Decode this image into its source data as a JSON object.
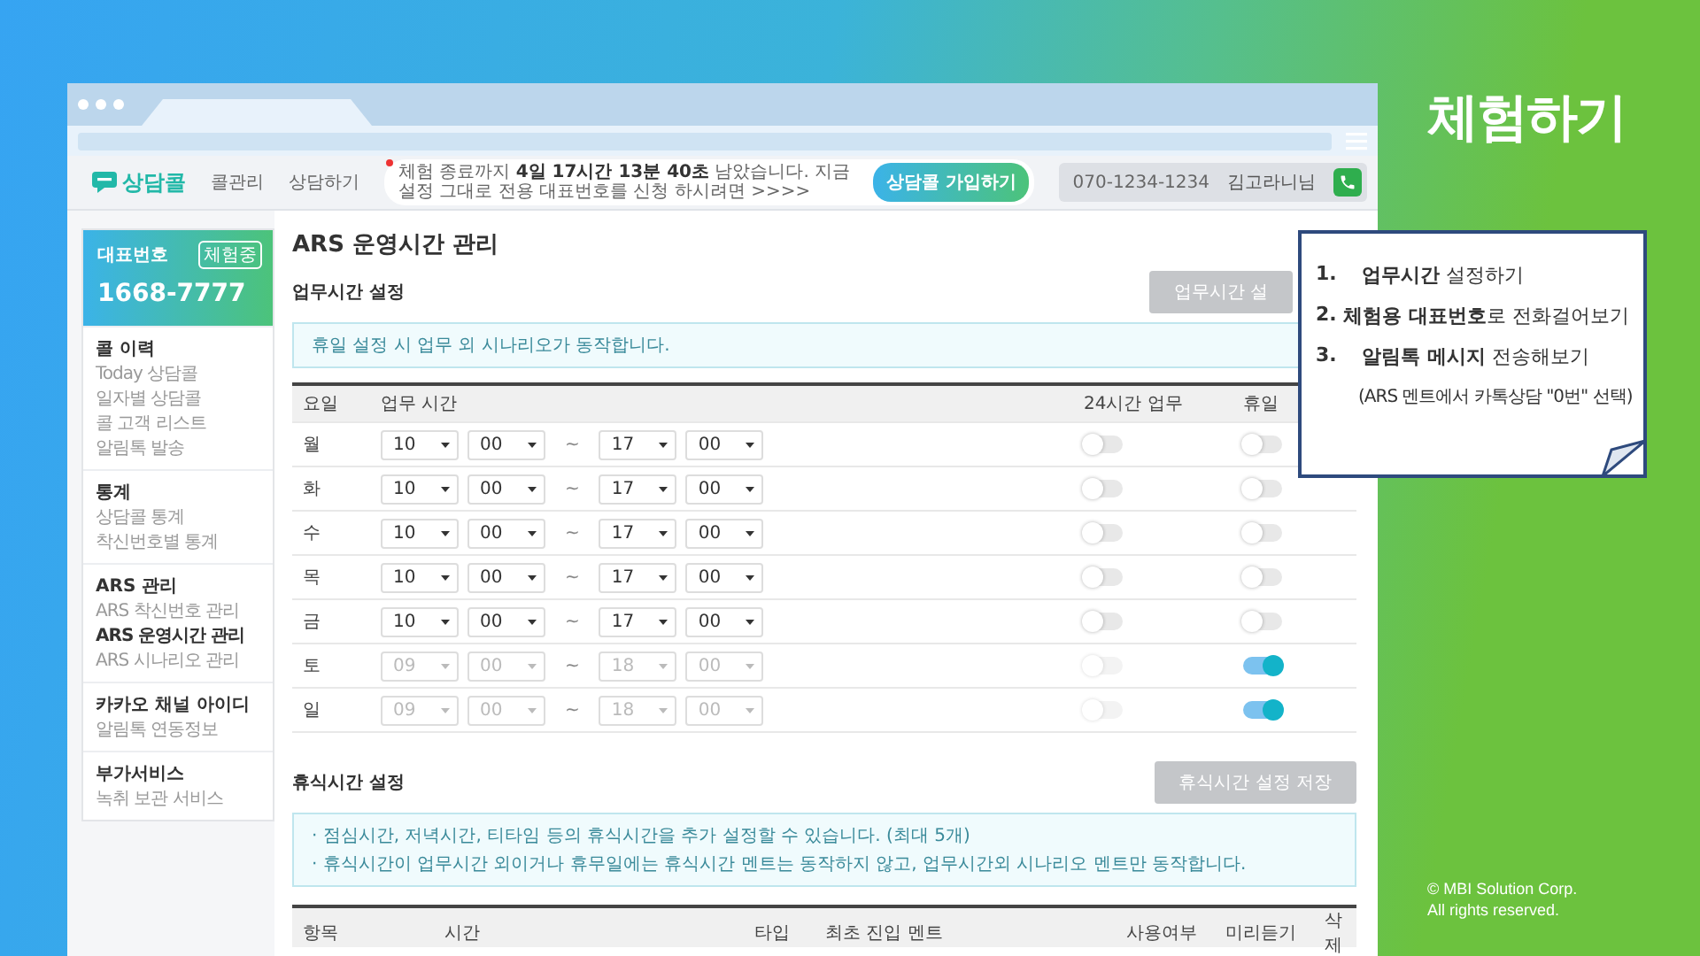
{
  "slide_title": "체험하기",
  "copyright": [
    "© MBI Solution Corp.",
    "All rights reserved."
  ],
  "callout": {
    "steps": [
      {
        "number": "1.",
        "text": "**업무시간** 설정하기"
      },
      {
        "number": "2.",
        "text": "**체험용 대표번호**로 전화걸어보기"
      },
      {
        "number": "3.",
        "text": "**알림톡 메시지** 전송해보기"
      }
    ],
    "note": "(ARS 멘트에서 카톡상담 \"0번\" 선택)"
  },
  "header": {
    "logo": "상담콜",
    "nav": [
      {
        "label": "콜관리",
        "selected": false
      },
      {
        "label": "상담하기",
        "selected": false
      }
    ],
    "notice": "체험 종료까지 **4일 17시간 13분 40초** 남았습니다. 지금 설정 그대로 전용 대표번호를 신청 하시려면 >>>>",
    "cta": "상담콜 가입하기",
    "phone": "070-1234-1234",
    "user": "김고라니님"
  },
  "sidebar": {
    "rep_label": "대표번호",
    "badge": "체험중",
    "rep_number": "1668-7777",
    "sections": [
      {
        "title": "콜 이력",
        "items": [
          {
            "label": "Today 상담콜",
            "selected": false
          },
          {
            "label": "일자별 상담콜",
            "selected": false
          },
          {
            "label": "콜 고객 리스트",
            "selected": false
          },
          {
            "label": "알림톡 발송",
            "selected": false
          }
        ]
      },
      {
        "title": "통계",
        "items": [
          {
            "label": "상담콜 통계",
            "selected": false
          },
          {
            "label": "착신번호별 통계",
            "selected": false
          }
        ]
      },
      {
        "title": "ARS 관리",
        "items": [
          {
            "label": "ARS 착신번호 관리",
            "selected": false
          },
          {
            "label": "ARS 운영시간 관리",
            "selected": true
          },
          {
            "label": "ARS 시나리오 관리",
            "selected": false
          }
        ]
      },
      {
        "title": "카카오 채널 아이디",
        "items": [
          {
            "label": "알림톡 연동정보",
            "selected": false
          }
        ]
      },
      {
        "title": "부가서비스",
        "items": [
          {
            "label": "녹취 보관 서비스",
            "selected": false
          }
        ]
      }
    ]
  },
  "page_title": "ARS 운영시간 관리",
  "business_hours": {
    "heading": "업무시간 설정",
    "save_button": "업무시간 설",
    "info": "휴일 설정 시 업무 외 시나리오가 동작합니다.",
    "columns": [
      "요일",
      "업무 시간",
      "24시간 업무",
      "휴일"
    ],
    "rows": [
      {
        "day": "월",
        "start_hour": "10",
        "start_min": "00",
        "end_hour": "17",
        "end_min": "00",
        "all_day": false,
        "holiday": false
      },
      {
        "day": "화",
        "start_hour": "10",
        "start_min": "00",
        "end_hour": "17",
        "end_min": "00",
        "all_day": false,
        "holiday": false
      },
      {
        "day": "수",
        "start_hour": "10",
        "start_min": "00",
        "end_hour": "17",
        "end_min": "00",
        "all_day": false,
        "holiday": false
      },
      {
        "day": "목",
        "start_hour": "10",
        "start_min": "00",
        "end_hour": "17",
        "end_min": "00",
        "all_day": false,
        "holiday": false
      },
      {
        "day": "금",
        "start_hour": "10",
        "start_min": "00",
        "end_hour": "17",
        "end_min": "00",
        "all_day": false,
        "holiday": false
      },
      {
        "day": "토",
        "start_hour": "09",
        "start_min": "00",
        "end_hour": "18",
        "end_min": "00",
        "all_day": false,
        "holiday": true
      },
      {
        "day": "일",
        "start_hour": "09",
        "start_min": "00",
        "end_hour": "18",
        "end_min": "00",
        "all_day": false,
        "holiday": true
      }
    ],
    "separator": "~"
  },
  "break_time": {
    "heading": "휴식시간 설정",
    "save_button": "휴식시간 설정 저장",
    "notes": [
      "· 점심시간, 저녁시간, 티타임 등의 휴식시간을 추가 설정할 수 있습니다. (최대 5개)",
      "· 휴식시간이 업무시간 외이거나 휴무일에는 휴식시간 멘트는 동작하지 않고, 업무시간외 시나리오 멘트만 동작합니다."
    ],
    "columns": [
      "항목",
      "시간",
      "타입",
      "최초 진입 멘트",
      "사용여부",
      "미리듣기",
      "삭제"
    ]
  }
}
